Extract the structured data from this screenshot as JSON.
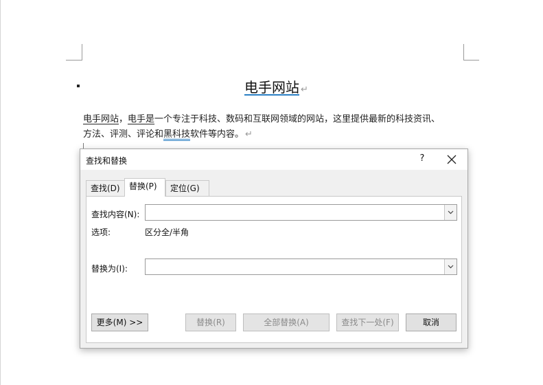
{
  "document": {
    "title": "电手网站",
    "paragraph_mark": "↵",
    "body_lines": [
      {
        "segments": [
          {
            "text": "电手网站",
            "style": "u-black"
          },
          {
            "text": "，",
            "style": ""
          },
          {
            "text": "电手是",
            "style": "u-black"
          },
          {
            "text": "一个专注于科技、数码和互联网领域的网站，这里提供最新的科技资讯、",
            "style": ""
          }
        ]
      },
      {
        "segments": [
          {
            "text": "方法、评测、评论和",
            "style": ""
          },
          {
            "text": "黑科技",
            "style": "u-blue"
          },
          {
            "text": "软件等内容。",
            "style": ""
          }
        ]
      }
    ]
  },
  "dialog": {
    "title": "查找和替换",
    "help_label": "?",
    "tabs": [
      {
        "label": "查找(D)",
        "active": false
      },
      {
        "label": "替换(P)",
        "active": true
      },
      {
        "label": "定位(G)",
        "active": false
      }
    ],
    "find_label": "查找内容(N):",
    "find_value": "",
    "options_label": "选项:",
    "options_value": "区分全/半角",
    "replace_label": "替换为(I):",
    "replace_value": "",
    "buttons": {
      "more": "更多(M) >>",
      "replace": "替换(R)",
      "replace_all": "全部替换(A)",
      "find_next": "查找下一处(F)",
      "cancel": "取消"
    }
  }
}
